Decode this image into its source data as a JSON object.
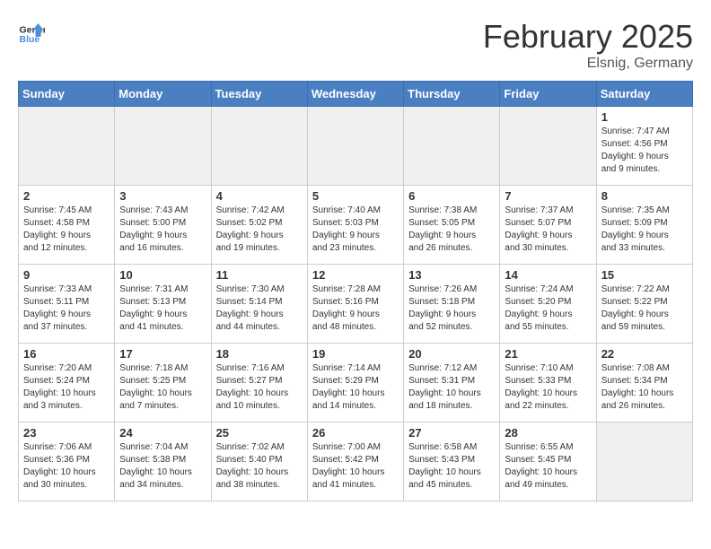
{
  "header": {
    "logo_line1": "General",
    "logo_line2": "Blue",
    "month": "February 2025",
    "location": "Elsnig, Germany"
  },
  "weekdays": [
    "Sunday",
    "Monday",
    "Tuesday",
    "Wednesday",
    "Thursday",
    "Friday",
    "Saturday"
  ],
  "weeks": [
    [
      {
        "num": "",
        "info": ""
      },
      {
        "num": "",
        "info": ""
      },
      {
        "num": "",
        "info": ""
      },
      {
        "num": "",
        "info": ""
      },
      {
        "num": "",
        "info": ""
      },
      {
        "num": "",
        "info": ""
      },
      {
        "num": "1",
        "info": "Sunrise: 7:47 AM\nSunset: 4:56 PM\nDaylight: 9 hours\nand 9 minutes."
      }
    ],
    [
      {
        "num": "2",
        "info": "Sunrise: 7:45 AM\nSunset: 4:58 PM\nDaylight: 9 hours\nand 12 minutes."
      },
      {
        "num": "3",
        "info": "Sunrise: 7:43 AM\nSunset: 5:00 PM\nDaylight: 9 hours\nand 16 minutes."
      },
      {
        "num": "4",
        "info": "Sunrise: 7:42 AM\nSunset: 5:02 PM\nDaylight: 9 hours\nand 19 minutes."
      },
      {
        "num": "5",
        "info": "Sunrise: 7:40 AM\nSunset: 5:03 PM\nDaylight: 9 hours\nand 23 minutes."
      },
      {
        "num": "6",
        "info": "Sunrise: 7:38 AM\nSunset: 5:05 PM\nDaylight: 9 hours\nand 26 minutes."
      },
      {
        "num": "7",
        "info": "Sunrise: 7:37 AM\nSunset: 5:07 PM\nDaylight: 9 hours\nand 30 minutes."
      },
      {
        "num": "8",
        "info": "Sunrise: 7:35 AM\nSunset: 5:09 PM\nDaylight: 9 hours\nand 33 minutes."
      }
    ],
    [
      {
        "num": "9",
        "info": "Sunrise: 7:33 AM\nSunset: 5:11 PM\nDaylight: 9 hours\nand 37 minutes."
      },
      {
        "num": "10",
        "info": "Sunrise: 7:31 AM\nSunset: 5:13 PM\nDaylight: 9 hours\nand 41 minutes."
      },
      {
        "num": "11",
        "info": "Sunrise: 7:30 AM\nSunset: 5:14 PM\nDaylight: 9 hours\nand 44 minutes."
      },
      {
        "num": "12",
        "info": "Sunrise: 7:28 AM\nSunset: 5:16 PM\nDaylight: 9 hours\nand 48 minutes."
      },
      {
        "num": "13",
        "info": "Sunrise: 7:26 AM\nSunset: 5:18 PM\nDaylight: 9 hours\nand 52 minutes."
      },
      {
        "num": "14",
        "info": "Sunrise: 7:24 AM\nSunset: 5:20 PM\nDaylight: 9 hours\nand 55 minutes."
      },
      {
        "num": "15",
        "info": "Sunrise: 7:22 AM\nSunset: 5:22 PM\nDaylight: 9 hours\nand 59 minutes."
      }
    ],
    [
      {
        "num": "16",
        "info": "Sunrise: 7:20 AM\nSunset: 5:24 PM\nDaylight: 10 hours\nand 3 minutes."
      },
      {
        "num": "17",
        "info": "Sunrise: 7:18 AM\nSunset: 5:25 PM\nDaylight: 10 hours\nand 7 minutes."
      },
      {
        "num": "18",
        "info": "Sunrise: 7:16 AM\nSunset: 5:27 PM\nDaylight: 10 hours\nand 10 minutes."
      },
      {
        "num": "19",
        "info": "Sunrise: 7:14 AM\nSunset: 5:29 PM\nDaylight: 10 hours\nand 14 minutes."
      },
      {
        "num": "20",
        "info": "Sunrise: 7:12 AM\nSunset: 5:31 PM\nDaylight: 10 hours\nand 18 minutes."
      },
      {
        "num": "21",
        "info": "Sunrise: 7:10 AM\nSunset: 5:33 PM\nDaylight: 10 hours\nand 22 minutes."
      },
      {
        "num": "22",
        "info": "Sunrise: 7:08 AM\nSunset: 5:34 PM\nDaylight: 10 hours\nand 26 minutes."
      }
    ],
    [
      {
        "num": "23",
        "info": "Sunrise: 7:06 AM\nSunset: 5:36 PM\nDaylight: 10 hours\nand 30 minutes."
      },
      {
        "num": "24",
        "info": "Sunrise: 7:04 AM\nSunset: 5:38 PM\nDaylight: 10 hours\nand 34 minutes."
      },
      {
        "num": "25",
        "info": "Sunrise: 7:02 AM\nSunset: 5:40 PM\nDaylight: 10 hours\nand 38 minutes."
      },
      {
        "num": "26",
        "info": "Sunrise: 7:00 AM\nSunset: 5:42 PM\nDaylight: 10 hours\nand 41 minutes."
      },
      {
        "num": "27",
        "info": "Sunrise: 6:58 AM\nSunset: 5:43 PM\nDaylight: 10 hours\nand 45 minutes."
      },
      {
        "num": "28",
        "info": "Sunrise: 6:55 AM\nSunset: 5:45 PM\nDaylight: 10 hours\nand 49 minutes."
      },
      {
        "num": "",
        "info": ""
      }
    ]
  ]
}
